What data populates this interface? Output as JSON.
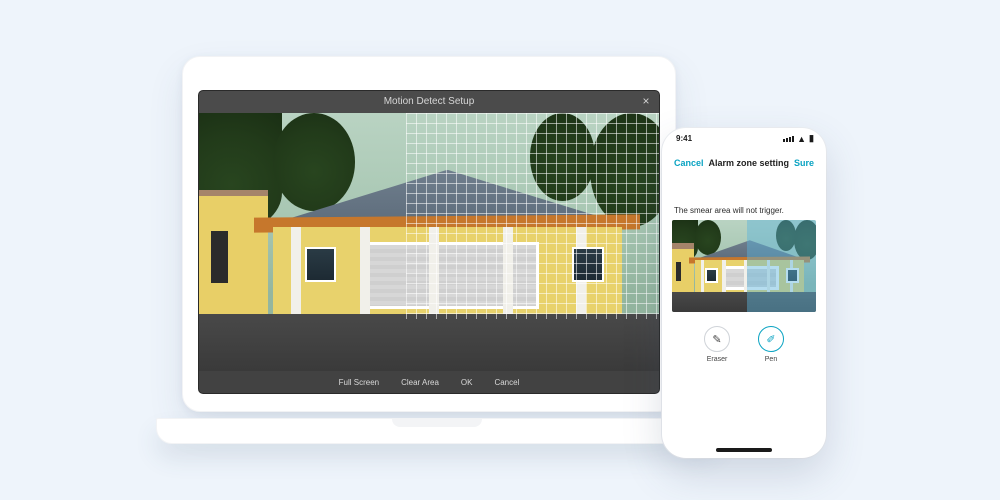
{
  "desktop": {
    "title": "Motion Detect Setup",
    "close": "×",
    "footer": {
      "full_screen": "Full Screen",
      "clear_area": "Clear Area",
      "ok": "OK",
      "cancel": "Cancel"
    }
  },
  "phone": {
    "status_time": "9:41",
    "nav_cancel": "Cancel",
    "nav_title": "Alarm zone setting",
    "nav_sure": "Sure",
    "hint": "The smear area will not trigger.",
    "tool_eraser": "Eraser",
    "tool_pen": "Pen"
  }
}
